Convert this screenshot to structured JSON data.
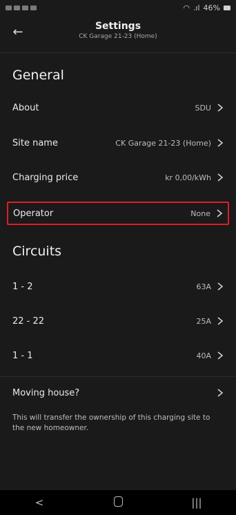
{
  "statusbar": {
    "battery": "46%"
  },
  "header": {
    "back_glyph": "←",
    "title": "Settings",
    "subtitle": "CK Garage 21-23 (Home)"
  },
  "general": {
    "title": "General",
    "rows": [
      {
        "label": "About",
        "value": "SDU"
      },
      {
        "label": "Site name",
        "value": "CK Garage 21-23 (Home)"
      },
      {
        "label": "Charging price",
        "value": "kr 0,00/kWh"
      },
      {
        "label": "Operator",
        "value": "None"
      }
    ]
  },
  "circuits": {
    "title": "Circuits",
    "rows": [
      {
        "label": "1 - 2",
        "value": "63A"
      },
      {
        "label": "22 - 22",
        "value": "25A"
      },
      {
        "label": "1 - 1",
        "value": "40A"
      }
    ]
  },
  "moving": {
    "label": "Moving house?",
    "note": "This will transfer the ownership of this charging site to the new homeowner."
  },
  "navbar": {
    "back": "<",
    "recents": "|||"
  },
  "colors": {
    "background": "#1a1a1a",
    "highlight_border": "#e01c26"
  }
}
